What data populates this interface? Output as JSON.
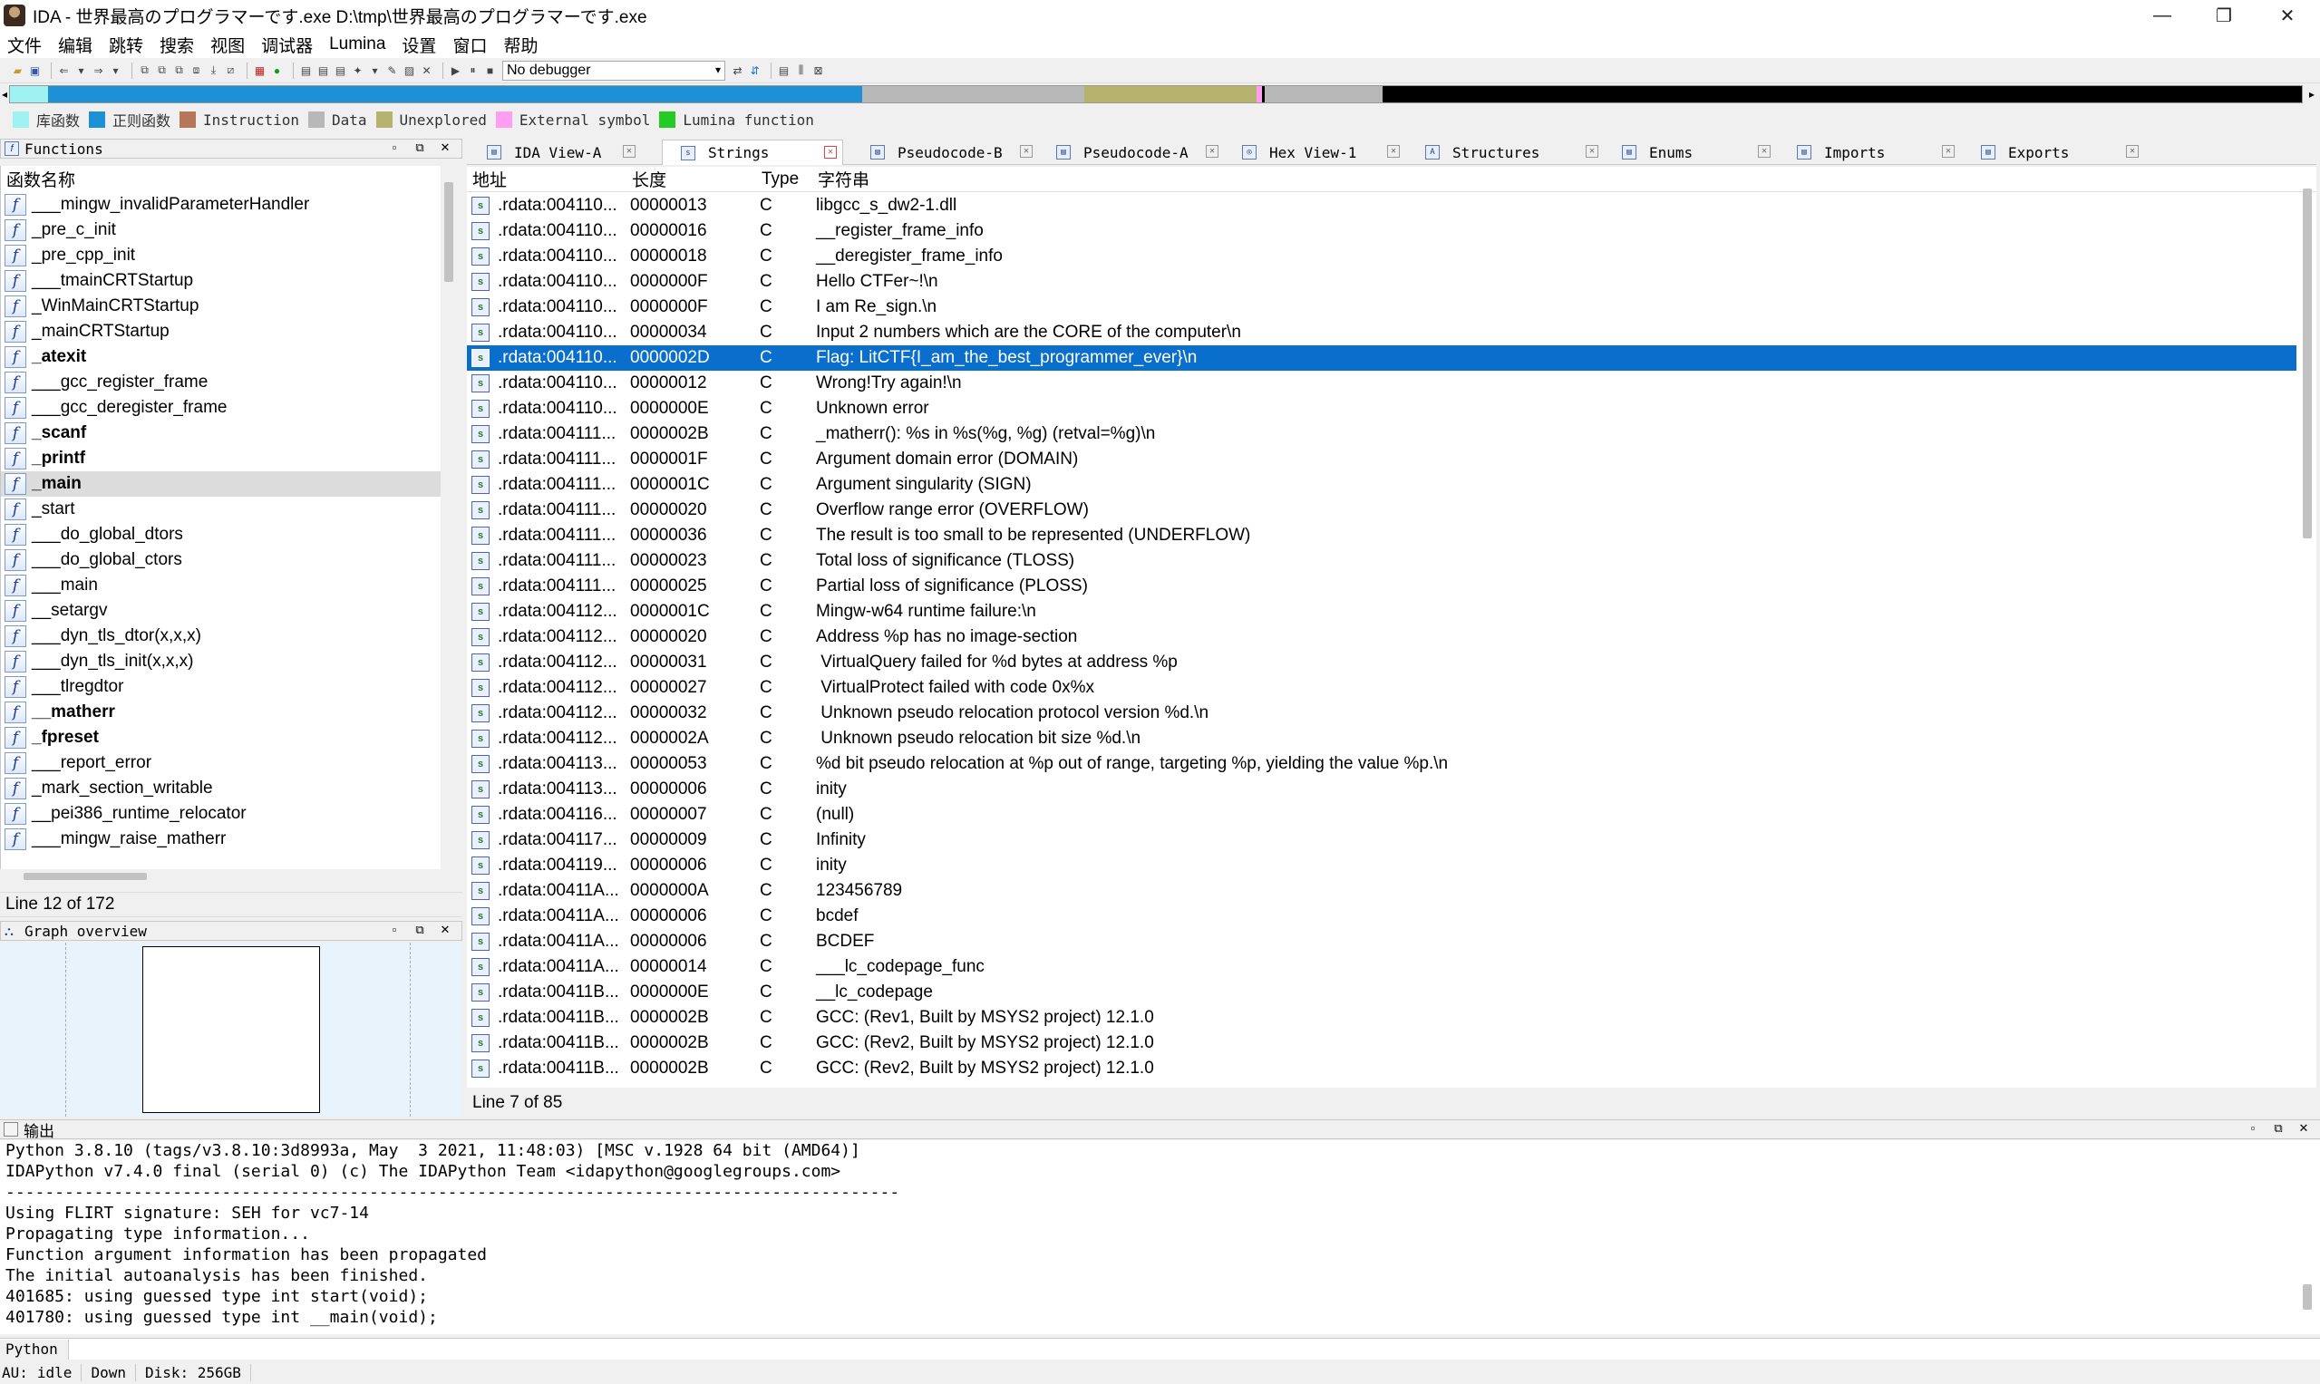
{
  "window": {
    "title": "IDA - 世界最高のプログラマーです.exe D:\\tmp\\世界最高のプログラマーです.exe",
    "minimize": "—",
    "maximize": "❐",
    "close": "✕"
  },
  "menu": [
    "文件",
    "编辑",
    "跳转",
    "搜索",
    "视图",
    "调试器",
    "Lumina",
    "设置",
    "窗口",
    "帮助"
  ],
  "toolbar": {
    "debugger": "No debugger"
  },
  "legend": [
    {
      "label": "库函数",
      "color": "#9ef2f2"
    },
    {
      "label": "正则函数",
      "color": "#1e90d6"
    },
    {
      "label": "Instruction",
      "color": "#b5765a"
    },
    {
      "label": "Data",
      "color": "#b8b8b8"
    },
    {
      "label": "Unexplored",
      "color": "#b5b36e"
    },
    {
      "label": "External symbol",
      "color": "#ff9ef2"
    },
    {
      "label": "Lumina function",
      "color": "#22cc22"
    }
  ],
  "functions": {
    "title": "Functions",
    "column": "函数名称",
    "items": [
      {
        "name": "___mingw_invalidParameterHandler",
        "bold": false
      },
      {
        "name": "_pre_c_init",
        "bold": false
      },
      {
        "name": "_pre_cpp_init",
        "bold": false
      },
      {
        "name": "___tmainCRTStartup",
        "bold": false
      },
      {
        "name": "_WinMainCRTStartup",
        "bold": false
      },
      {
        "name": "_mainCRTStartup",
        "bold": false
      },
      {
        "name": "_atexit",
        "bold": true
      },
      {
        "name": "___gcc_register_frame",
        "bold": false
      },
      {
        "name": "___gcc_deregister_frame",
        "bold": false
      },
      {
        "name": "_scanf",
        "bold": true
      },
      {
        "name": "_printf",
        "bold": true
      },
      {
        "name": "_main",
        "bold": true
      },
      {
        "name": "_start",
        "bold": false
      },
      {
        "name": "___do_global_dtors",
        "bold": false
      },
      {
        "name": "___do_global_ctors",
        "bold": false
      },
      {
        "name": "___main",
        "bold": false
      },
      {
        "name": "__setargv",
        "bold": false
      },
      {
        "name": "___dyn_tls_dtor(x,x,x)",
        "bold": false
      },
      {
        "name": "___dyn_tls_init(x,x,x)",
        "bold": false
      },
      {
        "name": "___tlregdtor",
        "bold": false
      },
      {
        "name": "__matherr",
        "bold": true
      },
      {
        "name": "_fpreset",
        "bold": true
      },
      {
        "name": "___report_error",
        "bold": false
      },
      {
        "name": "_mark_section_writable",
        "bold": false
      },
      {
        "name": "__pei386_runtime_relocator",
        "bold": false
      },
      {
        "name": "___mingw_raise_matherr",
        "bold": false
      }
    ],
    "status": "Line 12 of 172"
  },
  "graph": {
    "title": "Graph overview"
  },
  "tabs": [
    {
      "label": "IDA View-A",
      "icon": "▤"
    },
    {
      "label": "Strings",
      "icon": "s"
    },
    {
      "label": "Pseudocode-B",
      "icon": "▤"
    },
    {
      "label": "Pseudocode-A",
      "icon": "▤"
    },
    {
      "label": "Hex View-1",
      "icon": "◎"
    },
    {
      "label": "Structures",
      "icon": "A"
    },
    {
      "label": "Enums",
      "icon": "▤"
    },
    {
      "label": "Imports",
      "icon": "▤"
    },
    {
      "label": "Exports",
      "icon": "▤"
    }
  ],
  "strings": {
    "columns": {
      "address": "地址",
      "length": "长度",
      "type": "Type",
      "string": "字符串"
    },
    "rows": [
      [
        ".rdata:004110...",
        "00000013",
        "C",
        "libgcc_s_dw2-1.dll"
      ],
      [
        ".rdata:004110...",
        "00000016",
        "C",
        "__register_frame_info"
      ],
      [
        ".rdata:004110...",
        "00000018",
        "C",
        "__deregister_frame_info"
      ],
      [
        ".rdata:004110...",
        "0000000F",
        "C",
        "Hello CTFer~!\\n"
      ],
      [
        ".rdata:004110...",
        "0000000F",
        "C",
        "I am Re_sign.\\n"
      ],
      [
        ".rdata:004110...",
        "00000034",
        "C",
        "Input 2 numbers which are the CORE of the computer\\n"
      ],
      [
        ".rdata:004110...",
        "0000002D",
        "C",
        "Flag: LitCTF{I_am_the_best_programmer_ever}\\n"
      ],
      [
        ".rdata:004110...",
        "00000012",
        "C",
        "Wrong!Try again!\\n"
      ],
      [
        ".rdata:004110...",
        "0000000E",
        "C",
        "Unknown error"
      ],
      [
        ".rdata:004111...",
        "0000002B",
        "C",
        "_matherr(): %s in %s(%g, %g) (retval=%g)\\n"
      ],
      [
        ".rdata:004111...",
        "0000001F",
        "C",
        "Argument domain error (DOMAIN)"
      ],
      [
        ".rdata:004111...",
        "0000001C",
        "C",
        "Argument singularity (SIGN)"
      ],
      [
        ".rdata:004111...",
        "00000020",
        "C",
        "Overflow range error (OVERFLOW)"
      ],
      [
        ".rdata:004111...",
        "00000036",
        "C",
        "The result is too small to be represented (UNDERFLOW)"
      ],
      [
        ".rdata:004111...",
        "00000023",
        "C",
        "Total loss of significance (TLOSS)"
      ],
      [
        ".rdata:004111...",
        "00000025",
        "C",
        "Partial loss of significance (PLOSS)"
      ],
      [
        ".rdata:004112...",
        "0000001C",
        "C",
        "Mingw-w64 runtime failure:\\n"
      ],
      [
        ".rdata:004112...",
        "00000020",
        "C",
        "Address %p has no image-section"
      ],
      [
        ".rdata:004112...",
        "00000031",
        "C",
        " VirtualQuery failed for %d bytes at address %p"
      ],
      [
        ".rdata:004112...",
        "00000027",
        "C",
        " VirtualProtect failed with code 0x%x"
      ],
      [
        ".rdata:004112...",
        "00000032",
        "C",
        " Unknown pseudo relocation protocol version %d.\\n"
      ],
      [
        ".rdata:004112...",
        "0000002A",
        "C",
        " Unknown pseudo relocation bit size %d.\\n"
      ],
      [
        ".rdata:004113...",
        "00000053",
        "C",
        "%d bit pseudo relocation at %p out of range, targeting %p, yielding the value %p.\\n"
      ],
      [
        ".rdata:004113...",
        "00000006",
        "C",
        "inity"
      ],
      [
        ".rdata:004116...",
        "00000007",
        "C",
        "(null)"
      ],
      [
        ".rdata:004117...",
        "00000009",
        "C",
        "Infinity"
      ],
      [
        ".rdata:004119...",
        "00000006",
        "C",
        "inity"
      ],
      [
        ".rdata:00411A...",
        "0000000A",
        "C",
        "123456789"
      ],
      [
        ".rdata:00411A...",
        "00000006",
        "C",
        "bcdef"
      ],
      [
        ".rdata:00411A...",
        "00000006",
        "C",
        "BCDEF"
      ],
      [
        ".rdata:00411A...",
        "00000014",
        "C",
        "___lc_codepage_func"
      ],
      [
        ".rdata:00411B...",
        "0000000E",
        "C",
        "__lc_codepage"
      ],
      [
        ".rdata:00411B...",
        "0000002B",
        "C",
        "GCC: (Rev1, Built by MSYS2 project) 12.1.0"
      ],
      [
        ".rdata:00411B...",
        "0000002B",
        "C",
        "GCC: (Rev2, Built by MSYS2 project) 12.1.0"
      ],
      [
        ".rdata:00411B...",
        "0000002B",
        "C",
        "GCC: (Rev2, Built by MSYS2 project) 12.1.0"
      ]
    ],
    "selected_index": 6,
    "status": "Line 7 of 85"
  },
  "output": {
    "title": "输出",
    "lines": [
      "Python 3.8.10 (tags/v3.8.10:3d8993a, May  3 2021, 11:48:03) [MSC v.1928 64 bit (AMD64)]",
      "IDAPython v7.4.0 final (serial 0) (c) The IDAPython Team <idapython@googlegroups.com>",
      "-------------------------------------------------------------------------------------------",
      "Using FLIRT signature: SEH for vc7-14",
      "Propagating type information...",
      "Function argument information has been propagated",
      "The initial autoanalysis has been finished.",
      "401685: using guessed type int start(void);",
      "401780: using guessed type int __main(void);"
    ]
  },
  "cmdline": {
    "language": "Python"
  },
  "statusbar": {
    "au": "AU:",
    "state": "idle",
    "direction": "Down",
    "disk": "Disk: 256GB"
  }
}
